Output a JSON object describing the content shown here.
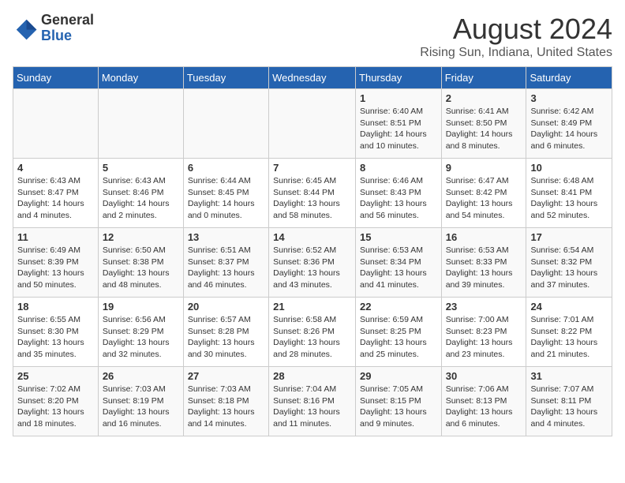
{
  "header": {
    "logo_line1": "General",
    "logo_line2": "Blue",
    "month_title": "August 2024",
    "location": "Rising Sun, Indiana, United States"
  },
  "weekdays": [
    "Sunday",
    "Monday",
    "Tuesday",
    "Wednesday",
    "Thursday",
    "Friday",
    "Saturday"
  ],
  "weeks": [
    [
      {
        "day": "",
        "info": ""
      },
      {
        "day": "",
        "info": ""
      },
      {
        "day": "",
        "info": ""
      },
      {
        "day": "",
        "info": ""
      },
      {
        "day": "1",
        "info": "Sunrise: 6:40 AM\nSunset: 8:51 PM\nDaylight: 14 hours\nand 10 minutes."
      },
      {
        "day": "2",
        "info": "Sunrise: 6:41 AM\nSunset: 8:50 PM\nDaylight: 14 hours\nand 8 minutes."
      },
      {
        "day": "3",
        "info": "Sunrise: 6:42 AM\nSunset: 8:49 PM\nDaylight: 14 hours\nand 6 minutes."
      }
    ],
    [
      {
        "day": "4",
        "info": "Sunrise: 6:43 AM\nSunset: 8:47 PM\nDaylight: 14 hours\nand 4 minutes."
      },
      {
        "day": "5",
        "info": "Sunrise: 6:43 AM\nSunset: 8:46 PM\nDaylight: 14 hours\nand 2 minutes."
      },
      {
        "day": "6",
        "info": "Sunrise: 6:44 AM\nSunset: 8:45 PM\nDaylight: 14 hours\nand 0 minutes."
      },
      {
        "day": "7",
        "info": "Sunrise: 6:45 AM\nSunset: 8:44 PM\nDaylight: 13 hours\nand 58 minutes."
      },
      {
        "day": "8",
        "info": "Sunrise: 6:46 AM\nSunset: 8:43 PM\nDaylight: 13 hours\nand 56 minutes."
      },
      {
        "day": "9",
        "info": "Sunrise: 6:47 AM\nSunset: 8:42 PM\nDaylight: 13 hours\nand 54 minutes."
      },
      {
        "day": "10",
        "info": "Sunrise: 6:48 AM\nSunset: 8:41 PM\nDaylight: 13 hours\nand 52 minutes."
      }
    ],
    [
      {
        "day": "11",
        "info": "Sunrise: 6:49 AM\nSunset: 8:39 PM\nDaylight: 13 hours\nand 50 minutes."
      },
      {
        "day": "12",
        "info": "Sunrise: 6:50 AM\nSunset: 8:38 PM\nDaylight: 13 hours\nand 48 minutes."
      },
      {
        "day": "13",
        "info": "Sunrise: 6:51 AM\nSunset: 8:37 PM\nDaylight: 13 hours\nand 46 minutes."
      },
      {
        "day": "14",
        "info": "Sunrise: 6:52 AM\nSunset: 8:36 PM\nDaylight: 13 hours\nand 43 minutes."
      },
      {
        "day": "15",
        "info": "Sunrise: 6:53 AM\nSunset: 8:34 PM\nDaylight: 13 hours\nand 41 minutes."
      },
      {
        "day": "16",
        "info": "Sunrise: 6:53 AM\nSunset: 8:33 PM\nDaylight: 13 hours\nand 39 minutes."
      },
      {
        "day": "17",
        "info": "Sunrise: 6:54 AM\nSunset: 8:32 PM\nDaylight: 13 hours\nand 37 minutes."
      }
    ],
    [
      {
        "day": "18",
        "info": "Sunrise: 6:55 AM\nSunset: 8:30 PM\nDaylight: 13 hours\nand 35 minutes."
      },
      {
        "day": "19",
        "info": "Sunrise: 6:56 AM\nSunset: 8:29 PM\nDaylight: 13 hours\nand 32 minutes."
      },
      {
        "day": "20",
        "info": "Sunrise: 6:57 AM\nSunset: 8:28 PM\nDaylight: 13 hours\nand 30 minutes."
      },
      {
        "day": "21",
        "info": "Sunrise: 6:58 AM\nSunset: 8:26 PM\nDaylight: 13 hours\nand 28 minutes."
      },
      {
        "day": "22",
        "info": "Sunrise: 6:59 AM\nSunset: 8:25 PM\nDaylight: 13 hours\nand 25 minutes."
      },
      {
        "day": "23",
        "info": "Sunrise: 7:00 AM\nSunset: 8:23 PM\nDaylight: 13 hours\nand 23 minutes."
      },
      {
        "day": "24",
        "info": "Sunrise: 7:01 AM\nSunset: 8:22 PM\nDaylight: 13 hours\nand 21 minutes."
      }
    ],
    [
      {
        "day": "25",
        "info": "Sunrise: 7:02 AM\nSunset: 8:20 PM\nDaylight: 13 hours\nand 18 minutes."
      },
      {
        "day": "26",
        "info": "Sunrise: 7:03 AM\nSunset: 8:19 PM\nDaylight: 13 hours\nand 16 minutes."
      },
      {
        "day": "27",
        "info": "Sunrise: 7:03 AM\nSunset: 8:18 PM\nDaylight: 13 hours\nand 14 minutes."
      },
      {
        "day": "28",
        "info": "Sunrise: 7:04 AM\nSunset: 8:16 PM\nDaylight: 13 hours\nand 11 minutes."
      },
      {
        "day": "29",
        "info": "Sunrise: 7:05 AM\nSunset: 8:15 PM\nDaylight: 13 hours\nand 9 minutes."
      },
      {
        "day": "30",
        "info": "Sunrise: 7:06 AM\nSunset: 8:13 PM\nDaylight: 13 hours\nand 6 minutes."
      },
      {
        "day": "31",
        "info": "Sunrise: 7:07 AM\nSunset: 8:11 PM\nDaylight: 13 hours\nand 4 minutes."
      }
    ]
  ]
}
